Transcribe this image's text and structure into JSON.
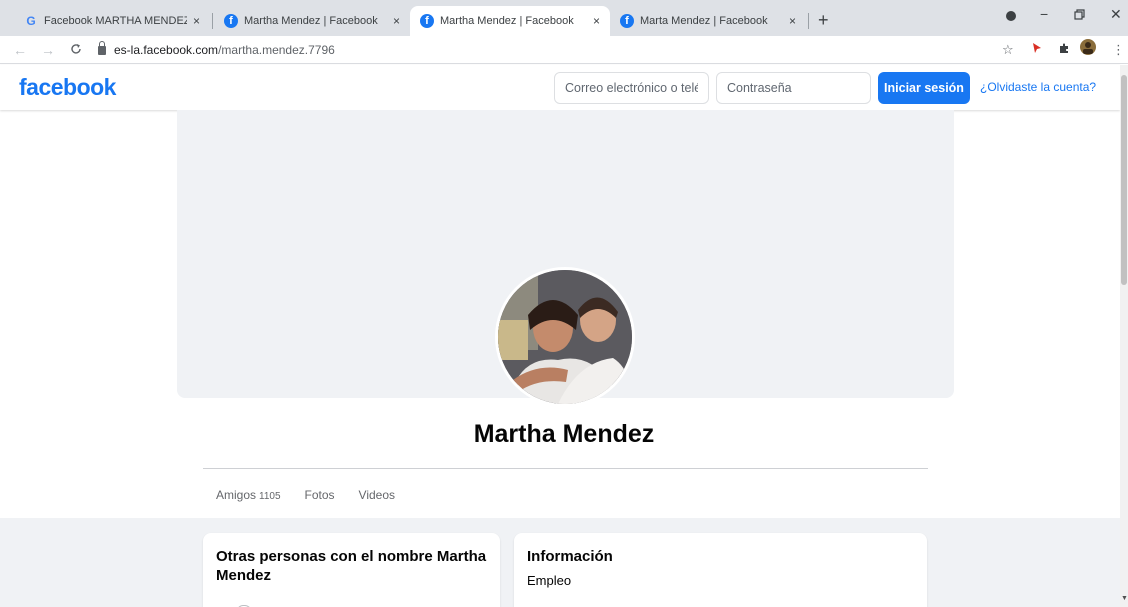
{
  "browser": {
    "tabs": [
      {
        "title": "Facebook MARTHA MENDEZ SOC",
        "favicon": "google-icon",
        "active": false
      },
      {
        "title": "Martha Mendez | Facebook",
        "favicon": "facebook-icon",
        "active": false
      },
      {
        "title": "Martha Mendez | Facebook",
        "favicon": "facebook-icon",
        "active": true
      },
      {
        "title": "Marta Mendez | Facebook",
        "favicon": "facebook-icon",
        "active": false
      }
    ],
    "new_tab": "+",
    "close_glyph": "×",
    "url_host": "es-la.facebook.com",
    "url_path": "/martha.mendez.7796"
  },
  "header": {
    "logo": "facebook",
    "email_placeholder": "Correo electrónico o teléfono",
    "password_placeholder": "Contraseña",
    "login_label": "Iniciar sesión",
    "forgot_label": "¿Olvidaste la cuenta?"
  },
  "profile": {
    "name": "Martha Mendez",
    "tabs": [
      {
        "label": "Amigos",
        "count": "1105"
      },
      {
        "label": "Fotos"
      },
      {
        "label": "Videos"
      }
    ]
  },
  "cards": {
    "others_title": "Otras personas con el nombre Martha Mendez",
    "info_title": "Información",
    "info_item": "Empleo"
  },
  "colors": {
    "brand": "#1877f2",
    "page_bg": "#f0f2f5"
  }
}
